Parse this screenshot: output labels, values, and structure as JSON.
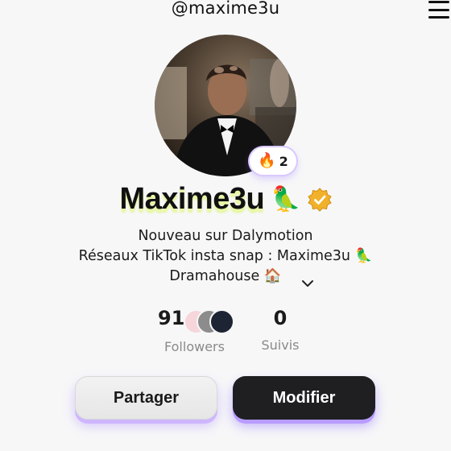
{
  "header": {
    "handle": "@maxime3u",
    "menu_icon": "hamburger-menu-icon"
  },
  "profile": {
    "display_name": "Maxime3u",
    "name_emoji": "🦜",
    "verified_icon": "verified-badge-icon",
    "streak": {
      "icon": "🔥",
      "count": "2"
    }
  },
  "bio": {
    "line1": "Nouveau sur Dalymotion",
    "line2": "Réseaux TikTok insta snap : Maxime3u 🦜",
    "line3": "Dramahouse 🏠",
    "expand_icon": "chevron-down-icon"
  },
  "stats": {
    "followers_count": "91",
    "followers_label": "Followers",
    "following_count": "0",
    "following_label": "Suivis"
  },
  "actions": {
    "share_label": "Partager",
    "edit_label": "Modifier"
  },
  "colors": {
    "accent_purple": "#b99cff",
    "name_highlight": "#e9f7a8",
    "verified_gold": "#f2b12b"
  }
}
